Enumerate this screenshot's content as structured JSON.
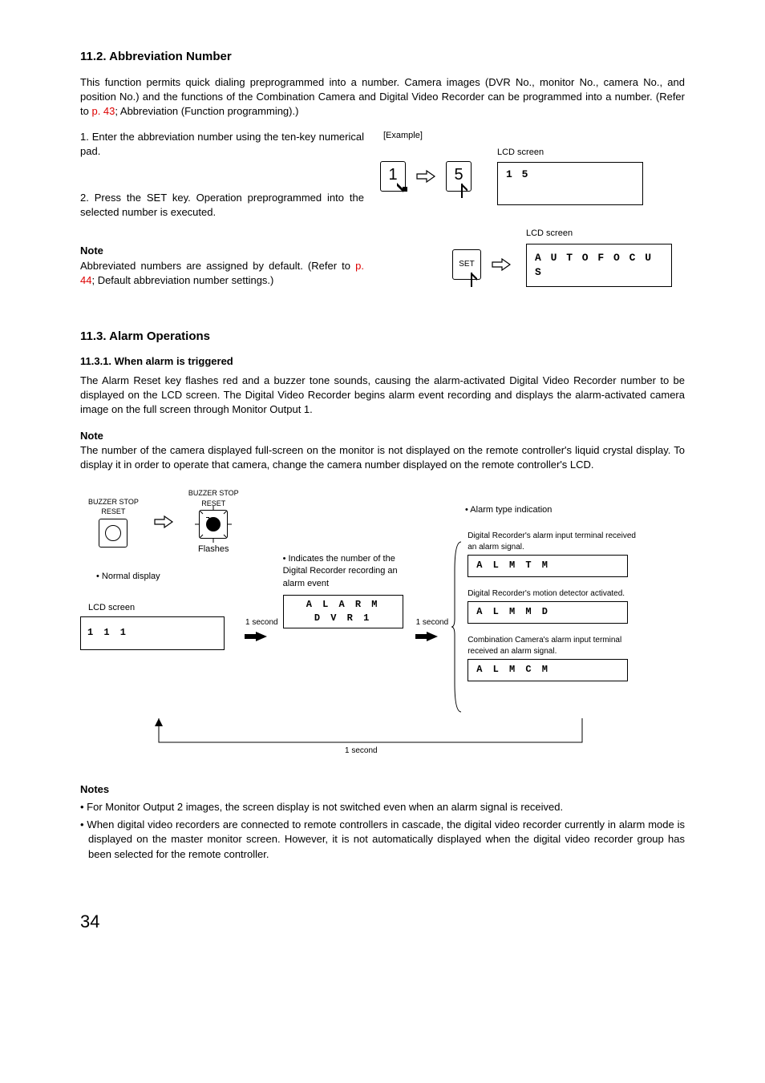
{
  "section112": {
    "heading": "11.2. Abbreviation Number",
    "intro_a": "This function permits quick dialing preprogrammed into a number. Camera images (DVR No., monitor No., camera No., and position No.) and the functions of the Combination Camera and Digital Video Recorder can be programmed into a number. (Refer to ",
    "intro_link": "p. 43",
    "intro_b": "; Abbreviation (Function programming).)",
    "step1": "1. Enter the abbreviation number using the ten-key numerical pad.",
    "step2": "2. Press the SET key. Operation preprogrammed into the selected number is executed.",
    "note_label": "Note",
    "note_a": "Abbreviated numbers are assigned by default. (Refer to ",
    "note_link": "p. 44",
    "note_b": "; Default abbreviation number settings.)",
    "example_label": "[Example]",
    "key1": "1",
    "key5": "5",
    "key_set": "SET",
    "lcd_label": "LCD screen",
    "lcd1_text": "1 5",
    "lcd2_text": "A U T O  F O C U S"
  },
  "section113": {
    "heading": "11.3. Alarm Operations",
    "sub1": "11.3.1. When alarm is triggered",
    "para1": "The Alarm Reset key flashes red and a buzzer tone sounds, causing the alarm-activated Digital Video Recorder number to be displayed on the LCD screen. The Digital Video Recorder begins alarm event recording and displays the alarm-activated camera image on the full screen through Monitor Output 1.",
    "note_label": "Note",
    "note_text": "The number of the camera displayed full-screen on the monitor is not displayed on the remote controller's liquid crystal display. To display it in order to operate that camera, change the camera number displayed on the remote controller's LCD.",
    "buzzer_top": "BUZZER STOP",
    "buzzer_bottom": "RESET",
    "flashes": "Flashes",
    "normal_display": "• Normal display",
    "lcd_label": "LCD screen",
    "lcd_normal": "1    1    1",
    "one_second": "1 second",
    "indicates": "• Indicates the number of the Digital Recorder recording an alarm event",
    "lcd_alarm1": "A L A R M",
    "lcd_alarm2": "D V R  1",
    "alarm_type": "• Alarm type indication",
    "tm_desc": "Digital Recorder's alarm input terminal received an alarm signal.",
    "alm_tm": "A L M  T M",
    "md_desc": "Digital Recorder's motion detector activated.",
    "alm_md": "A L M  M D",
    "cm_desc": "Combination Camera's alarm input terminal received an alarm signal.",
    "alm_cm": "A L M  C M",
    "notes_label": "Notes",
    "notes_b1": "• For Monitor Output 2 images, the screen display is not switched even when an alarm signal is received.",
    "notes_b2": "• When digital video recorders are connected to remote controllers in cascade, the digital video recorder currently in alarm mode is displayed on the master monitor screen. However, it is not automatically displayed when the digital video recorder group has been selected for the remote controller."
  },
  "page_number": "34"
}
